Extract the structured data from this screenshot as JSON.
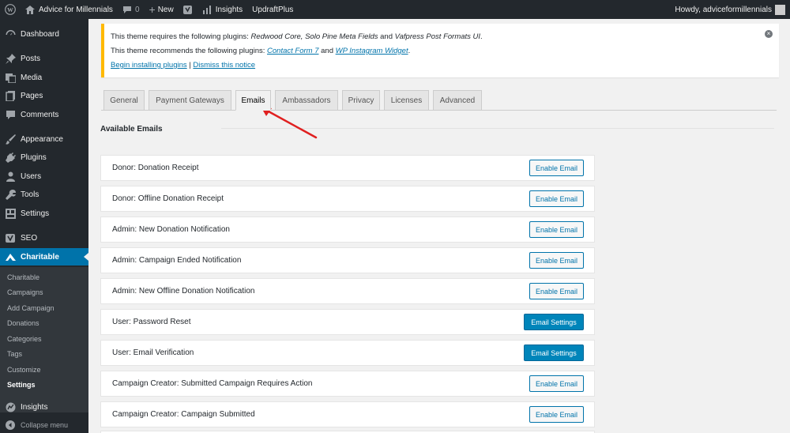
{
  "adminbar": {
    "site_name": "Advice for Millennials",
    "comments_count": "0",
    "new_label": "New",
    "insights_label": "Insights",
    "updraft_label": "UpdraftPlus",
    "howdy": "Howdy, adviceformillennials"
  },
  "sidebar": {
    "dashboard": "Dashboard",
    "posts": "Posts",
    "media": "Media",
    "pages": "Pages",
    "comments": "Comments",
    "appearance": "Appearance",
    "plugins": "Plugins",
    "users": "Users",
    "tools": "Tools",
    "settings": "Settings",
    "seo": "SEO",
    "charitable": "Charitable",
    "insights": "Insights",
    "collapse": "Collapse menu",
    "submenu": [
      "Charitable",
      "Campaigns",
      "Add Campaign",
      "Donations",
      "Categories",
      "Tags",
      "Customize",
      "Settings"
    ]
  },
  "notice": {
    "l1_prefix": "This theme requires the following plugins: ",
    "l1_plugins": "Redwood Core, Solo Pine Meta Fields",
    "l1_and": " and ",
    "l1_last": "Vafpress Post Formats UI",
    "l1_end": ".",
    "l2_prefix": "This theme recommends the following plugins: ",
    "l2_plugin1": "Contact Form 7",
    "l2_and": " and ",
    "l2_plugin2": "WP Instagram Widget",
    "l2_end": ".",
    "begin_link": "Begin installing plugins",
    "sep": " | ",
    "dismiss_link": "Dismiss this notice"
  },
  "tabs": [
    "General",
    "Payment Gateways",
    "Emails",
    "Ambassadors",
    "Privacy",
    "Licenses",
    "Advanced"
  ],
  "section_title": "Available Emails",
  "emails": [
    {
      "label": "Donor: Donation Receipt",
      "button": "Enable Email"
    },
    {
      "label": "Donor: Offline Donation Receipt",
      "button": "Enable Email"
    },
    {
      "label": "Admin: New Donation Notification",
      "button": "Enable Email"
    },
    {
      "label": "Admin: Campaign Ended Notification",
      "button": "Enable Email"
    },
    {
      "label": "Admin: New Offline Donation Notification",
      "button": "Enable Email"
    },
    {
      "label": "User: Password Reset",
      "button": "Email Settings"
    },
    {
      "label": "User: Email Verification",
      "button": "Email Settings"
    },
    {
      "label": "Campaign Creator: Submitted Campaign Requires Action",
      "button": "Enable Email"
    },
    {
      "label": "Campaign Creator: Campaign Submitted",
      "button": "Enable Email"
    }
  ],
  "colors": {
    "admin_bg": "#23282d",
    "accent": "#0073aa",
    "primary_button": "#0085ba",
    "notice_border": "#ffb900",
    "annotation_arrow": "#e02020"
  }
}
